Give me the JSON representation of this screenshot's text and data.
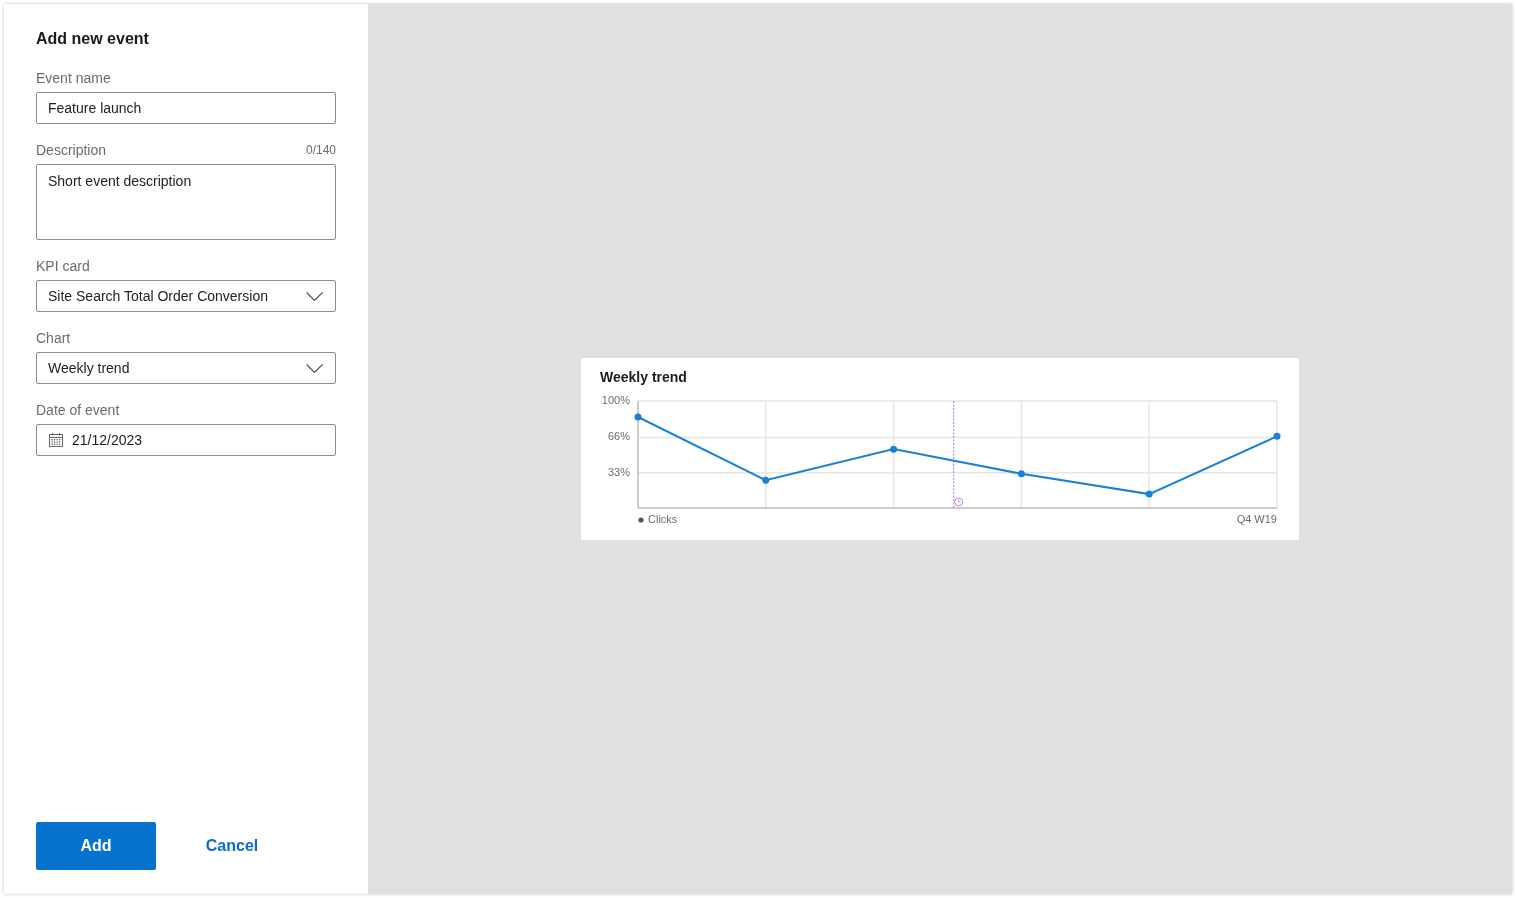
{
  "panel": {
    "title": "Add new event",
    "fields": [
      {
        "kind": "text",
        "label": "Event name",
        "value": "Feature launch"
      },
      {
        "kind": "textarea",
        "label": "Description",
        "counter": "0/140",
        "placeholder": "Short event description"
      },
      {
        "kind": "select",
        "label": "KPI card",
        "value": "Site Search Total Order Conversion"
      },
      {
        "kind": "select",
        "label": "Chart",
        "value": "Weekly trend"
      },
      {
        "kind": "date",
        "label": "Date of event",
        "value": "21/12/2023"
      }
    ],
    "buttons": [
      {
        "kind": "primary",
        "label": "Add"
      },
      {
        "kind": "link",
        "label": "Cancel"
      }
    ]
  },
  "preview": {
    "card": {
      "chart_data": {
        "type": "line",
        "title": "Weekly trend",
        "xlabel": "Q4 W19",
        "series": [
          {
            "name": "Clicks",
            "color": "#1a80d8",
            "marker": "circle",
            "values": [
              85,
              26,
              55,
              32,
              13,
              67
            ]
          }
        ],
        "ylim": [
          0,
          100
        ],
        "yticks": [
          {
            "value": 33,
            "label": "33%"
          },
          {
            "value": 66,
            "label": "66%"
          },
          {
            "value": 100,
            "label": "100%"
          }
        ],
        "grid": true
      }
    }
  }
}
